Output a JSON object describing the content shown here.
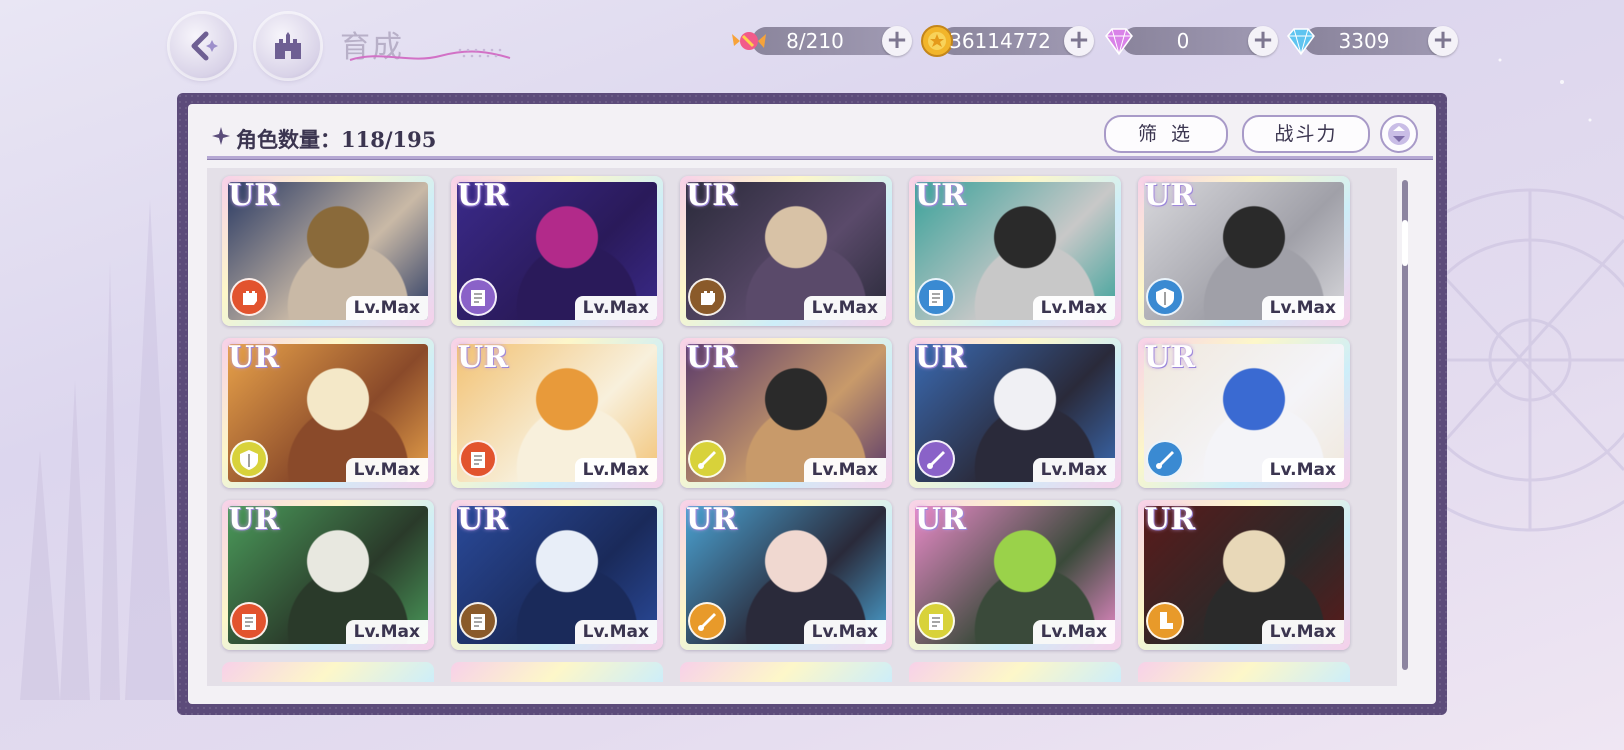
{
  "header": {
    "title": "育成",
    "resources": [
      {
        "name": "candy",
        "value": "8/210",
        "icon": "candy-icon"
      },
      {
        "name": "coin",
        "value": "36114772",
        "icon": "coin-icon"
      },
      {
        "name": "pink-gem",
        "value": "0",
        "icon": "pink-gem-icon"
      },
      {
        "name": "diamond",
        "value": "3309",
        "icon": "diamond-icon"
      }
    ]
  },
  "panel": {
    "count_label": "角色数量：118/195",
    "filter_label": "筛 选",
    "sort_label": "战斗力"
  },
  "cards": [
    {
      "rarity": "UR",
      "level": "Lv.Max",
      "type": "fist",
      "type_color": "#e2532e",
      "palette": [
        "#2a3a64",
        "#8a6a3a",
        "#c9b9a6"
      ]
    },
    {
      "rarity": "UR",
      "level": "Lv.Max",
      "type": "book",
      "type_color": "#8a62c8",
      "palette": [
        "#3a2a8a",
        "#b22a8a",
        "#2a1a5a"
      ]
    },
    {
      "rarity": "UR",
      "level": "Lv.Max",
      "type": "fist",
      "type_color": "#8a5a2a",
      "palette": [
        "#2a2a3a",
        "#d8c2a6",
        "#5a4a6a"
      ]
    },
    {
      "rarity": "UR",
      "level": "Lv.Max",
      "type": "book",
      "type_color": "#3a8ad2",
      "palette": [
        "#3aa29a",
        "#2a2a2a",
        "#c8c8c8"
      ]
    },
    {
      "rarity": "UR",
      "level": "Lv.Max",
      "type": "shield",
      "type_color": "#3a8ad2",
      "palette": [
        "#d8d8dc",
        "#2a2a2a",
        "#a0a0a8"
      ]
    },
    {
      "rarity": "UR",
      "level": "Lv.Max",
      "type": "shield",
      "type_color": "#d8d23a",
      "palette": [
        "#e8a24a",
        "#f4e8c8",
        "#8a4a2a"
      ]
    },
    {
      "rarity": "UR",
      "level": "Lv.Max",
      "type": "book",
      "type_color": "#e2532e",
      "palette": [
        "#f2c274",
        "#e89a3a",
        "#f8f0dc"
      ]
    },
    {
      "rarity": "UR",
      "level": "Lv.Max",
      "type": "trumpet",
      "type_color": "#d8d23a",
      "palette": [
        "#5a3a6a",
        "#2a2a2a",
        "#c89a6a"
      ]
    },
    {
      "rarity": "UR",
      "level": "Lv.Max",
      "type": "trumpet",
      "type_color": "#8a62c8",
      "palette": [
        "#3a6ab2",
        "#f0f0f4",
        "#2a2a3a"
      ]
    },
    {
      "rarity": "UR",
      "level": "Lv.Max",
      "type": "trumpet",
      "type_color": "#3a8ad2",
      "palette": [
        "#f0e8dc",
        "#3a6ad2",
        "#f4f4f8"
      ]
    },
    {
      "rarity": "UR",
      "level": "Lv.Max",
      "type": "book",
      "type_color": "#e2532e",
      "palette": [
        "#4a9a5a",
        "#e8e8e0",
        "#2a3a2a"
      ]
    },
    {
      "rarity": "UR",
      "level": "Lv.Max",
      "type": "book",
      "type_color": "#8a5a2a",
      "palette": [
        "#2a4a9a",
        "#e8eef8",
        "#1a2a5a"
      ]
    },
    {
      "rarity": "UR",
      "level": "Lv.Max",
      "type": "trumpet",
      "type_color": "#e89a2a",
      "palette": [
        "#4aa2d2",
        "#f0d8d0",
        "#2a2a3a"
      ]
    },
    {
      "rarity": "UR",
      "level": "Lv.Max",
      "type": "book",
      "type_color": "#d8d23a",
      "palette": [
        "#e88ac8",
        "#9ad24a",
        "#3a4a3a"
      ]
    },
    {
      "rarity": "UR",
      "level": "Lv.Max",
      "type": "boot",
      "type_color": "#e89a2a",
      "palette": [
        "#5a1a1a",
        "#e8d8b8",
        "#2a2a2a"
      ]
    }
  ],
  "colors": {
    "panel_border": "#5c4b7a",
    "accent": "#a89ac8"
  }
}
